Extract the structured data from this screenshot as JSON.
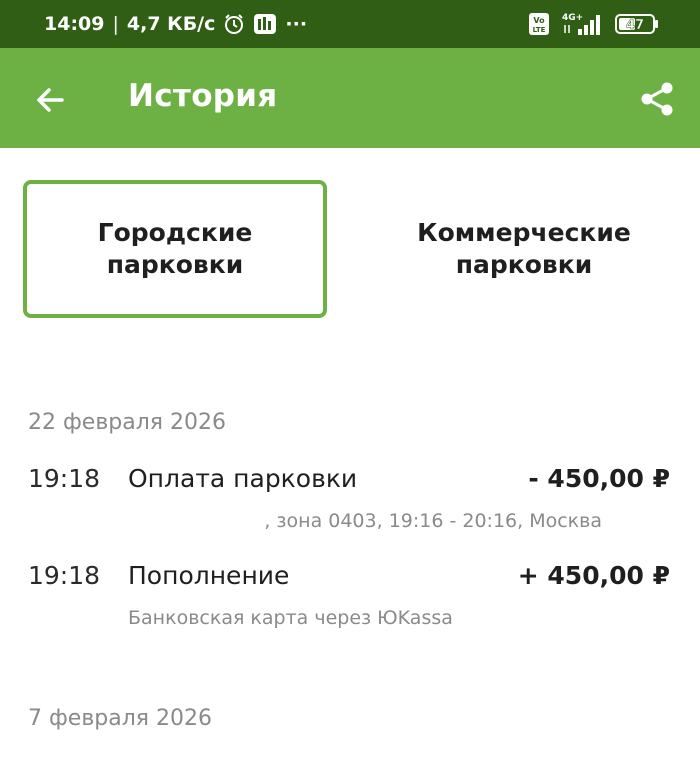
{
  "status_bar": {
    "time": "14:09",
    "separator": "|",
    "speed": "4,7 КБ/с",
    "more": "···",
    "volte": "Vo LTE",
    "network": "4G+",
    "battery": "47"
  },
  "app_bar": {
    "title": "История",
    "back_icon": "arrow-back-icon",
    "share_icon": "share-icon",
    "background": "#6db044"
  },
  "tabs": [
    {
      "label": "Городские парковки",
      "active": true
    },
    {
      "label": "Коммерческие парковки",
      "active": false
    }
  ],
  "history": [
    {
      "date": "22 февраля 2026",
      "transactions": [
        {
          "time": "19:18",
          "title": "Оплата парковки",
          "amount": "- 450,00 ₽",
          "detail": ", зона 0403, 19:16 - 20:16, Москва"
        },
        {
          "time": "19:18",
          "title": "Пополнение",
          "amount": "+ 450,00 ₽",
          "detail": "Банковская карта через ЮKassa"
        }
      ]
    },
    {
      "date": "7 февраля 2026",
      "transactions": []
    }
  ],
  "colors": {
    "status_bar": "#2f5e14",
    "accent": "#6db044",
    "muted_text": "#8a8a8a"
  }
}
